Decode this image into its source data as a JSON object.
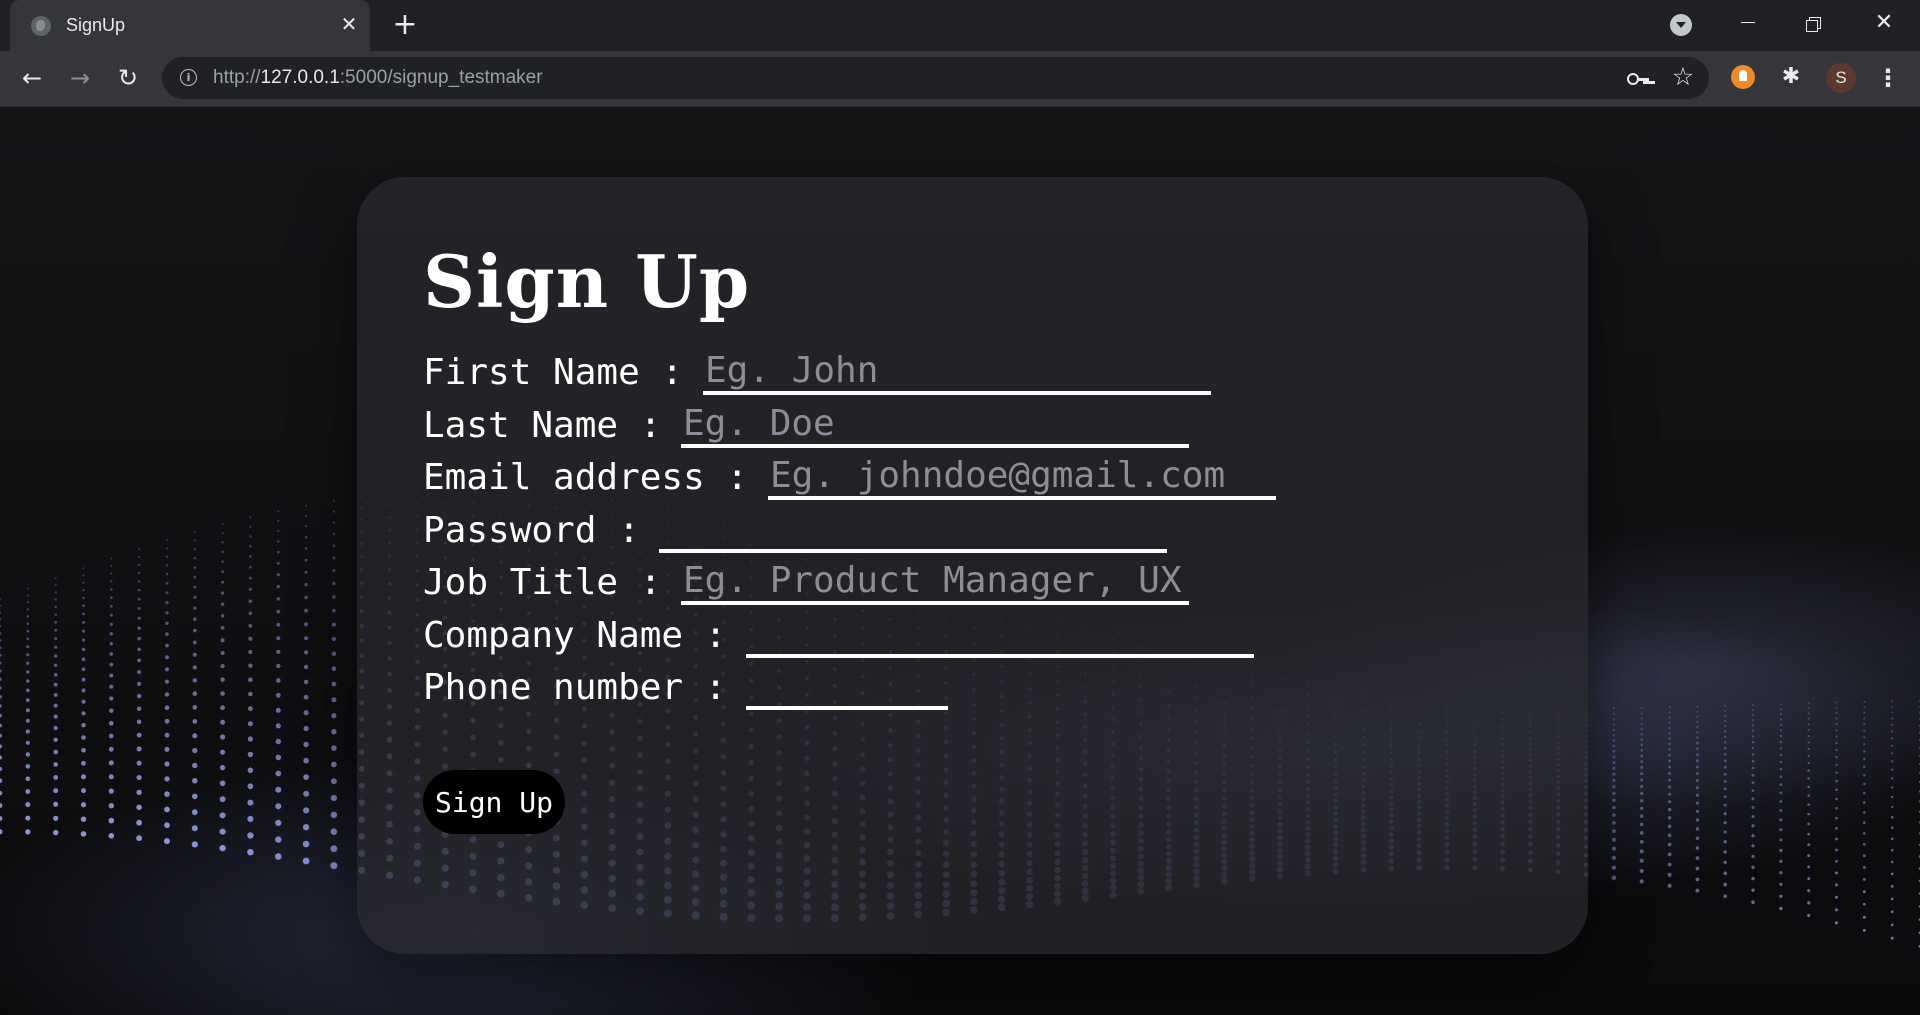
{
  "browser": {
    "tab_title": "SignUp",
    "tab_close": "✕",
    "new_tab": "+",
    "url_scheme": "http://",
    "url_host": "127.0.0.1",
    "url_rest": ":5000/signup_testmaker",
    "profile_initial": "S",
    "accent_color": "#f08a24"
  },
  "form": {
    "title": "Sign Up",
    "fields": [
      {
        "label": "First Name :",
        "placeholder": "Eg. John"
      },
      {
        "label": "Last Name :",
        "placeholder": "Eg. Doe"
      },
      {
        "label": "Email address :",
        "placeholder": "Eg. johndoe@gmail.com"
      },
      {
        "label": "Password :",
        "placeholder": ""
      },
      {
        "label": "Job Title :",
        "placeholder": "Eg. Product Manager, UX"
      },
      {
        "label": "Company Name :",
        "placeholder": ""
      },
      {
        "label": "Phone number :",
        "placeholder": ""
      }
    ],
    "submit_label": "Sign Up"
  }
}
